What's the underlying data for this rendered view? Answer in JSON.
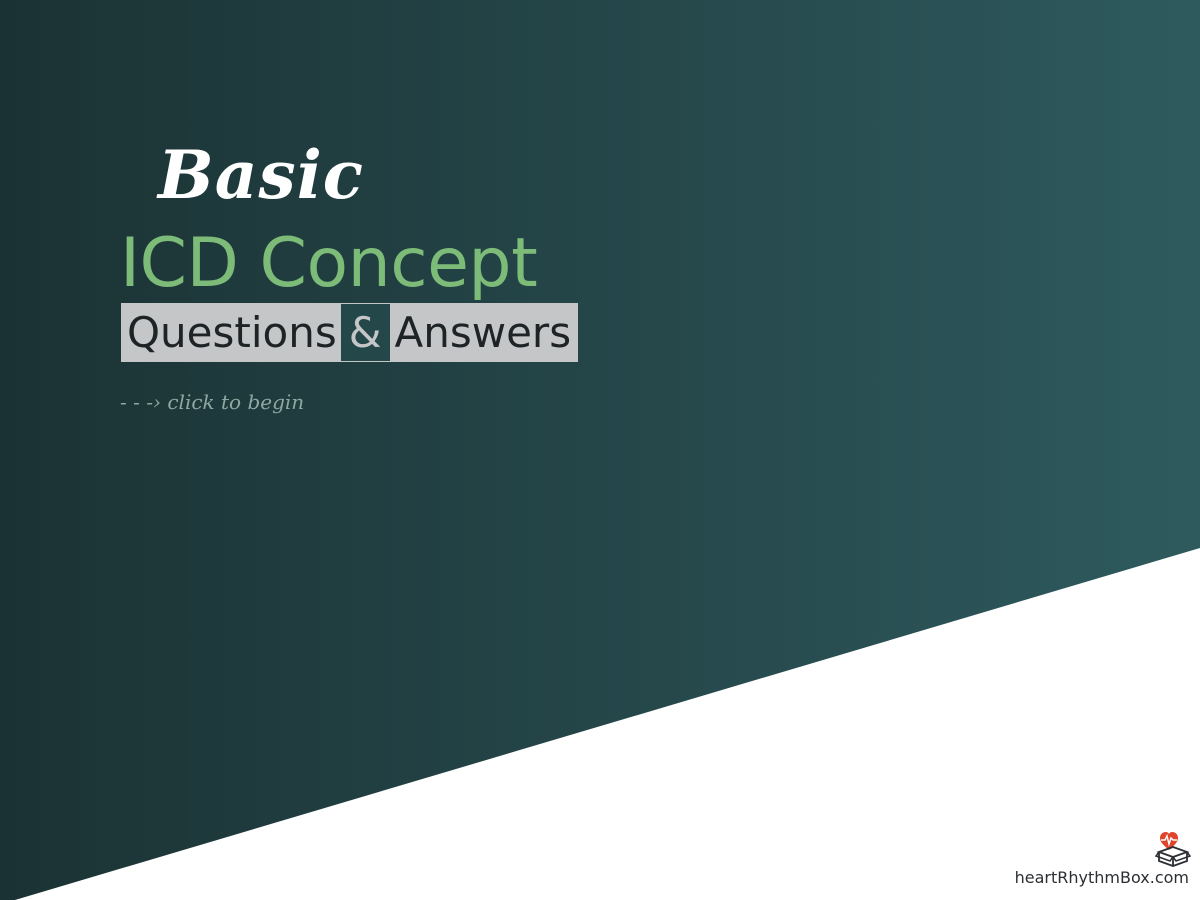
{
  "title": {
    "script_word": "Basic",
    "main": "ICD Concept",
    "questions": "Questions",
    "ampersand": "&",
    "answers": "Answers"
  },
  "cta": {
    "label": "- - -› click to begin"
  },
  "footer": {
    "site": "heartRhythmBox.com",
    "logo_icon": "heart-rhythm-box-logo-icon"
  },
  "colors": {
    "background_dark_left": "#1b3234",
    "background_dark_right": "#2e5a5e",
    "background_light": "#ffffff",
    "title_green": "#7dbb78",
    "qa_box_bg": "#c5c6c8",
    "ampersand_bg": "#24474a",
    "cta_text": "#8ea7a2",
    "logo_heart": "#e0452b"
  }
}
